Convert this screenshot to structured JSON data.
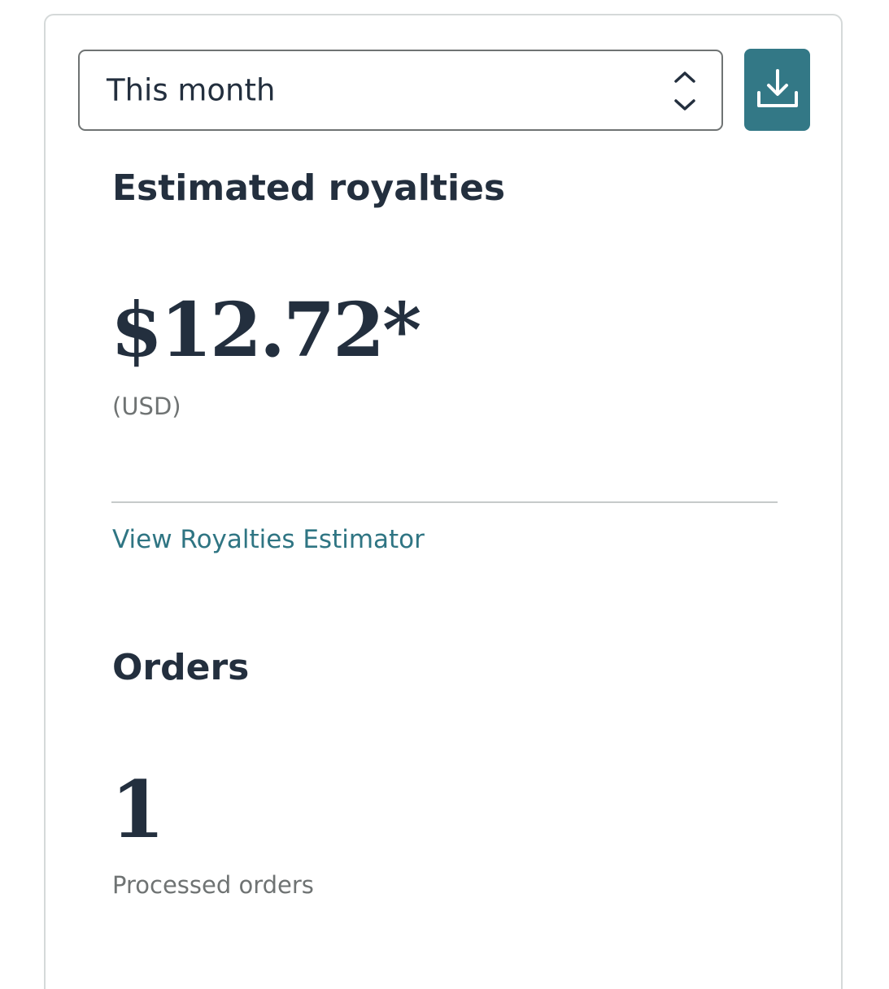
{
  "period_select": {
    "selected": "This month",
    "chevron_icon": "chevron-up-down-icon"
  },
  "download_button": {
    "icon": "download-icon",
    "color": "#337886"
  },
  "royalties": {
    "title": "Estimated royalties",
    "amount": "$12.72*",
    "currency": "(USD)",
    "estimator_link": "View Royalties Estimator"
  },
  "orders": {
    "title": "Orders",
    "count": "1",
    "caption": "Processed orders"
  },
  "colors": {
    "text_primary": "#232f3e",
    "text_secondary": "#6f7373",
    "link": "#2f7583",
    "accent": "#337886"
  }
}
